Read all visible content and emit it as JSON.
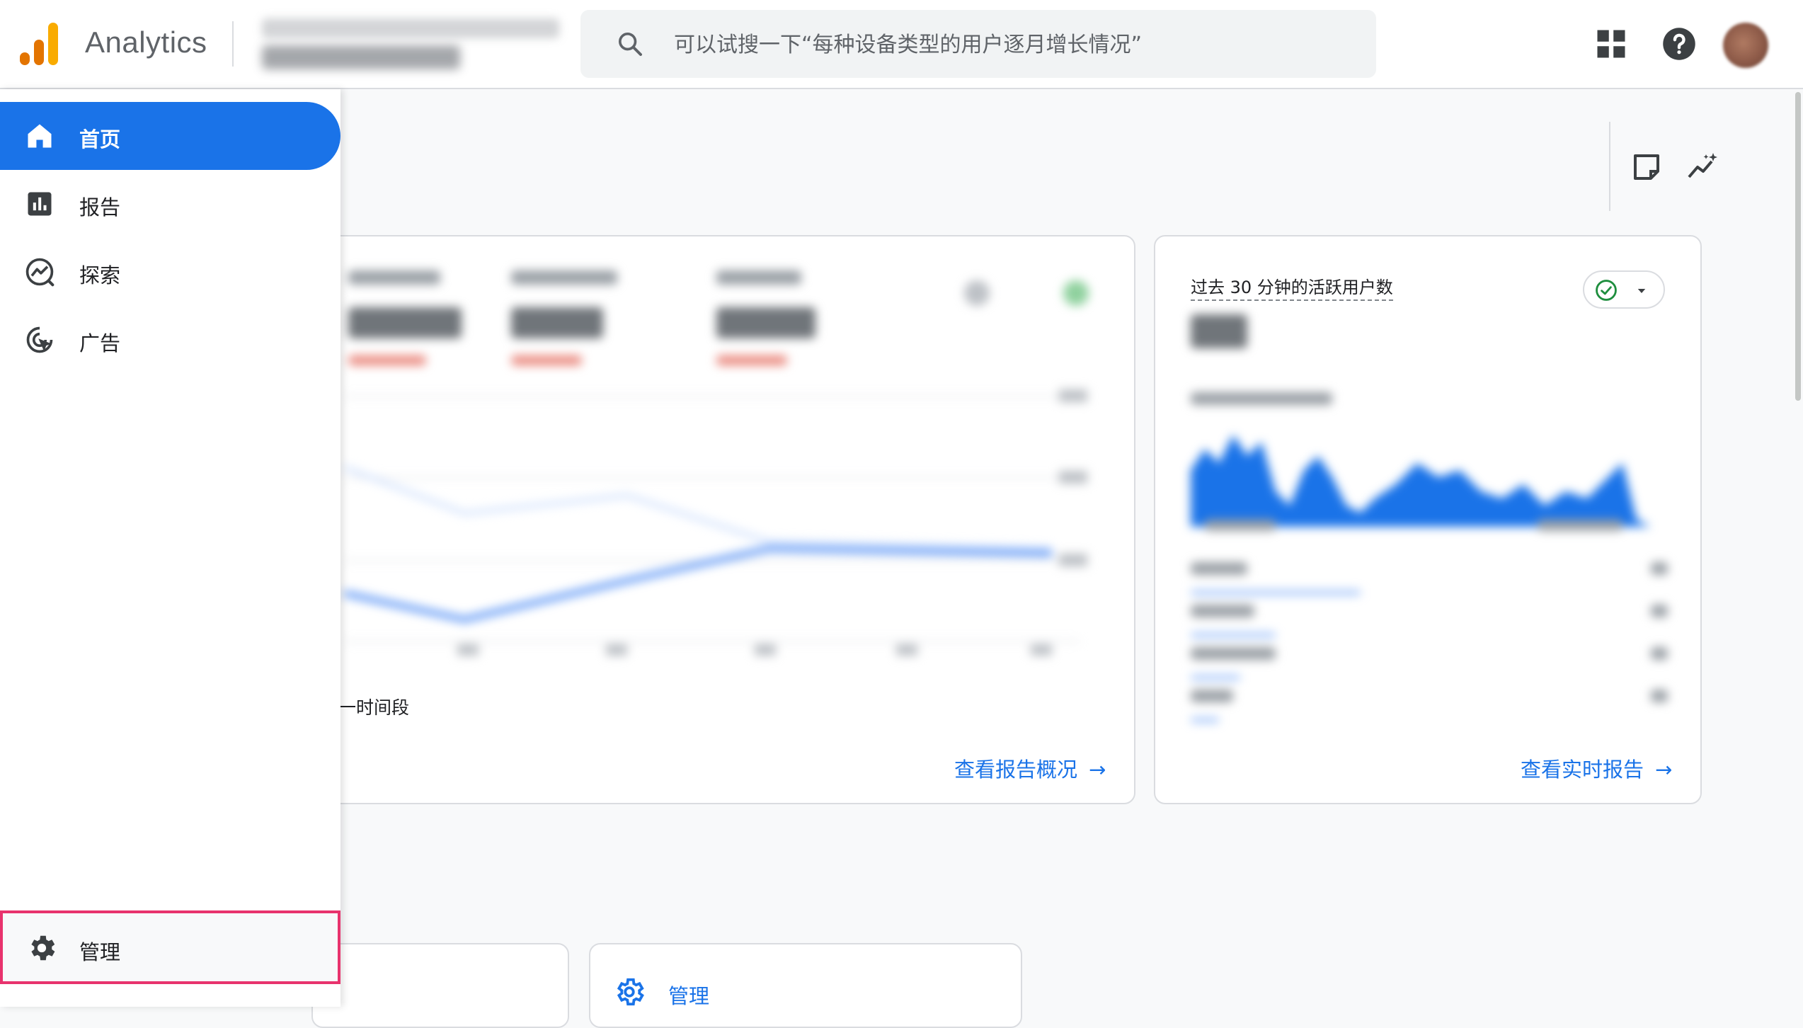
{
  "header": {
    "app_title": "Analytics",
    "search_placeholder": "可以试搜一下“每种设备类型的用户逐月增长情况”",
    "search_icon": "search-icon",
    "apps_icon": "apps-grid-icon",
    "help_icon": "help-icon",
    "avatar": "account-avatar",
    "logo_colors": [
      "#f9ab00",
      "#e37400",
      "#e37400"
    ]
  },
  "sidebar": {
    "items": [
      {
        "label": "首页",
        "icon": "home-icon",
        "active": true
      },
      {
        "label": "报告",
        "icon": "bar-chart-icon",
        "active": false
      },
      {
        "label": "探索",
        "icon": "explore-icon",
        "active": false
      },
      {
        "label": "广告",
        "icon": "ads-target-icon",
        "active": false
      }
    ],
    "admin": {
      "label": "管理",
      "icon": "gear-icon",
      "highlight_color": "#e8336d"
    }
  },
  "main": {
    "overview_card": {
      "legend_fragment": "一时间段",
      "link_label": "查看报告概况"
    },
    "realtime_card": {
      "title": "过去 30 分钟的活跃用户数",
      "link_label": "查看实时报告"
    },
    "bottom_card": {
      "title": "管理"
    }
  },
  "colors": {
    "accent": "#1a73e8",
    "success": "#1e8e3e",
    "highlight": "#e8336d"
  }
}
